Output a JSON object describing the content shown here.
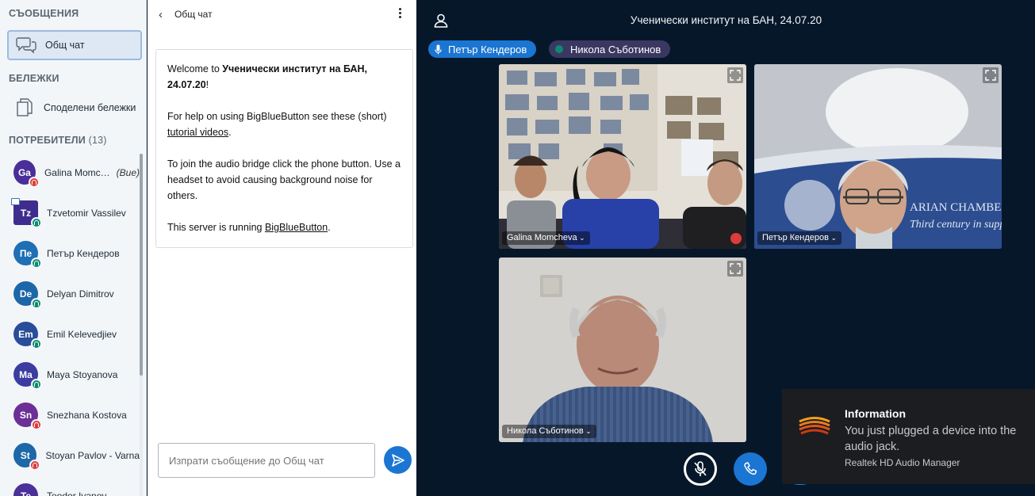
{
  "sidebar": {
    "messages_title": "СЪОБЩЕНИЯ",
    "public_chat": "Общ чат",
    "notes_title": "БЕЛЕЖКИ",
    "shared_notes": "Споделени бележки",
    "users_title": "ПОТРЕБИТЕЛИ",
    "users_count": "(13)",
    "users": [
      {
        "initials": "Ga",
        "name": "Galina Momc…",
        "away": "(Вие)",
        "color": "#4a2f9a",
        "status": "muted"
      },
      {
        "initials": "Tz",
        "name": "Tzvetomir Vassilev",
        "color": "#3e2d8f",
        "status": "listen",
        "presenter": true
      },
      {
        "initials": "Пе",
        "name": "Петър Кендеров",
        "color": "#1f6fb5",
        "status": "listen"
      },
      {
        "initials": "De",
        "name": "Delyan Dimitrov",
        "color": "#1d67a8",
        "status": "listen"
      },
      {
        "initials": "Em",
        "name": "Emil Kelevedjiev",
        "color": "#2a4d9a",
        "status": "listen"
      },
      {
        "initials": "Ma",
        "name": "Maya Stoyanova",
        "color": "#3b3da0",
        "status": "listen"
      },
      {
        "initials": "Sn",
        "name": "Snezhana Kostova",
        "color": "#6b2f96",
        "status": "muted"
      },
      {
        "initials": "St",
        "name": "Stoyan Pavlov - Varna",
        "color": "#1c68a8",
        "status": "muted"
      },
      {
        "initials": "Te",
        "name": "Teodor Ivanov",
        "color": "#4b2f9a",
        "status": "muted"
      }
    ]
  },
  "chat": {
    "title": "Общ чат",
    "welcome_prefix": "Welcome to ",
    "welcome_room": "Ученически институт на БАН, 24.07.20",
    "welcome_suffix": "!",
    "help_prefix": "For help on using BigBlueButton see these (short) ",
    "help_link": "tutorial videos",
    "help_suffix": ".",
    "audio_text": "To join the audio bridge click the phone button. Use a headset to avoid causing background noise for others.",
    "server_prefix": "This server is running ",
    "server_link": "BigBlueButton",
    "server_suffix": ".",
    "input_placeholder": "Изпрати съобщение до Общ чат"
  },
  "main": {
    "meeting_title": "Ученически институт на БАН, 24.07.20",
    "talkers": [
      "Петър Кендеров",
      "Никола Съботинов"
    ],
    "videos": [
      {
        "name": "Galina Momcheva",
        "muted": true
      },
      {
        "name": "Петър Кендеров",
        "muted": false
      },
      {
        "name": "Никола Съботинов",
        "muted": false
      }
    ],
    "banner_text": "Third century in supp",
    "banner_text2": "ARIAN CHAMBER"
  },
  "notification": {
    "title": "Information",
    "body": "You just plugged a device into the audio jack.",
    "source": "Realtek HD Audio Manager"
  },
  "colors": {
    "accent": "#1b75d2",
    "main_bg": "#06172a",
    "muted": "#de3b3b",
    "listen": "#0c8a6f"
  }
}
